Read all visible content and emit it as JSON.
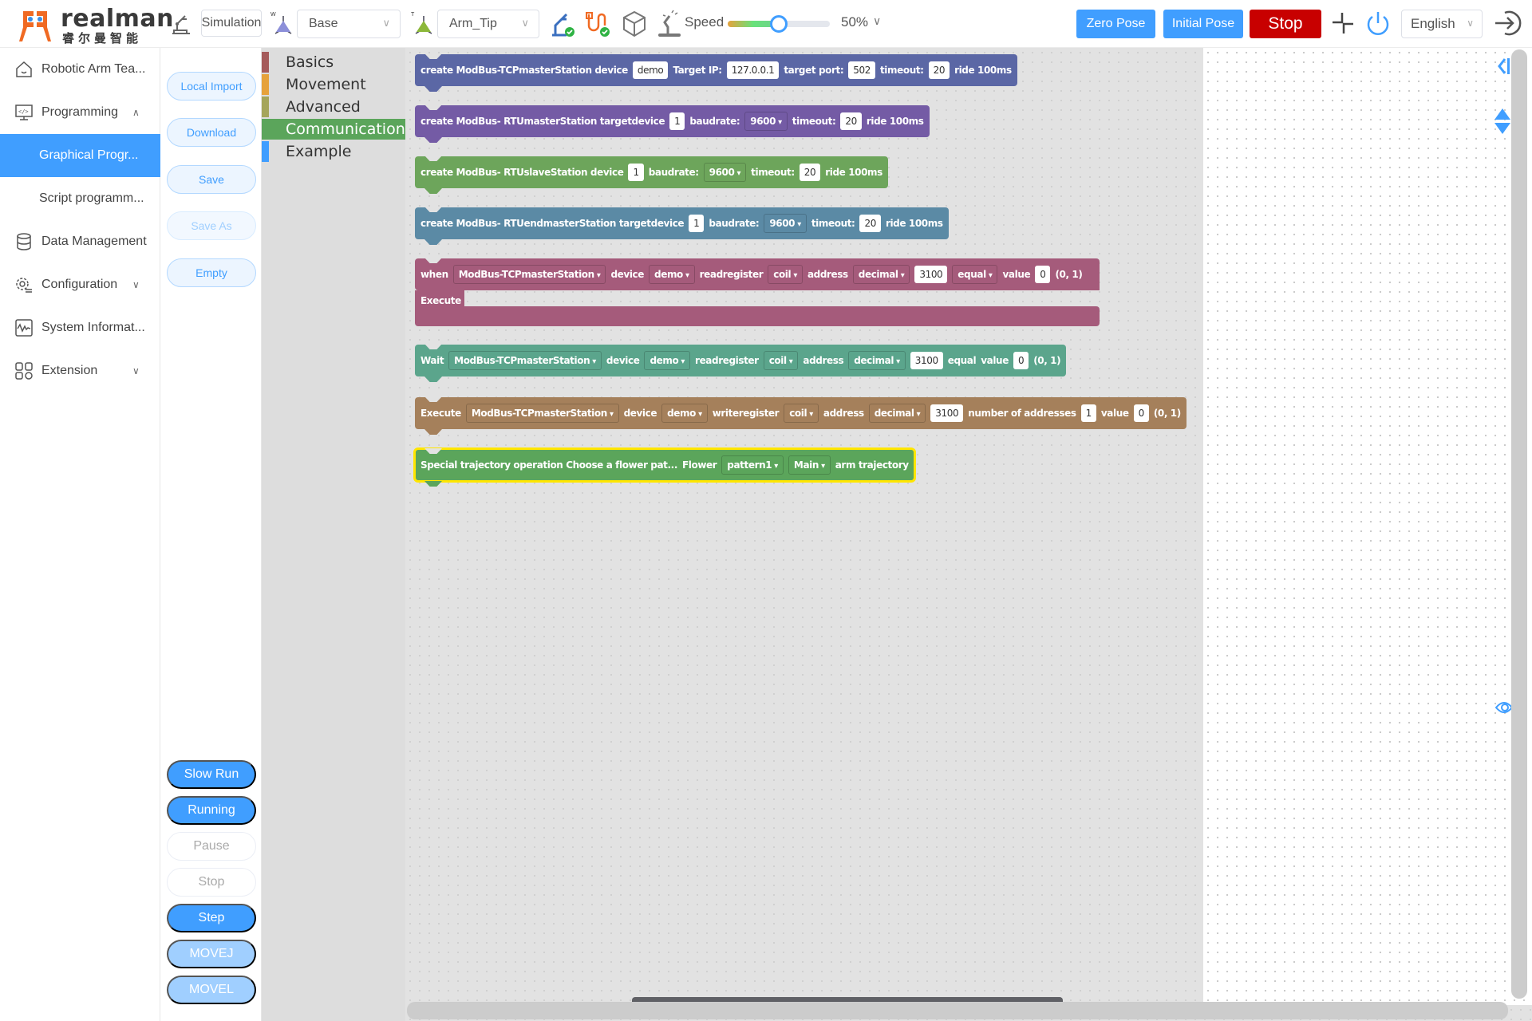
{
  "header": {
    "brand": "realman",
    "brand_cn": "睿尔曼智能",
    "mode": "Simulation",
    "work_frame": "Base",
    "tool_frame": "Arm_Tip",
    "speed_label": "Speed",
    "speed_percent": 50,
    "speed_value_text": "50%",
    "buttons": {
      "zero_pose": "Zero Pose",
      "initial_pose": "Initial Pose",
      "stop": "Stop"
    },
    "language": "English",
    "colors": {
      "accent": "#409eff",
      "stop": "#c80000",
      "logo": "#f06a23"
    }
  },
  "nav": {
    "items": [
      {
        "label": "Robotic Arm Tea...",
        "icon": "home-icon"
      },
      {
        "label": "Programming",
        "icon": "code-monitor-icon",
        "expanded": true
      },
      {
        "label": "Graphical Progr...",
        "active": true
      },
      {
        "label": "Script programm..."
      },
      {
        "label": "Data Management",
        "icon": "database-icon"
      },
      {
        "label": "Configuration",
        "icon": "gear-list-icon"
      },
      {
        "label": "System Informat...",
        "icon": "pulse-icon"
      },
      {
        "label": "Extension",
        "icon": "grid-icon"
      }
    ]
  },
  "actions": {
    "file": [
      "Local Import",
      "Download",
      "Save",
      "Save As",
      "Empty"
    ],
    "run": [
      "Slow Run",
      "Running",
      "Pause",
      "Stop",
      "Step",
      "MOVEJ",
      "MOVEL"
    ]
  },
  "toolbox": {
    "categories": [
      {
        "label": "Basics",
        "color": "#a55b5b"
      },
      {
        "label": "Movement",
        "color": "#e6a23c"
      },
      {
        "label": "Advanced",
        "color": "#a5a55b"
      },
      {
        "label": "Communication",
        "color": "#5ba55b",
        "selected": true
      },
      {
        "label": "Example",
        "color": "#409eff"
      }
    ]
  },
  "blocks": {
    "b1": {
      "t1": "create ModBus-TCPmasterStation device",
      "device": "demo",
      "t2": "Target IP:",
      "ip": "127.0.0.1",
      "t3": "target port:",
      "port": "502",
      "t4": "timeout:",
      "timeout": "20",
      "t5": "ride 100ms"
    },
    "b2": {
      "t1": "create ModBus- RTUmasterStation targetdevice",
      "device": "1",
      "t2": "baudrate:",
      "baud": "9600",
      "t3": "timeout:",
      "timeout": "20",
      "t4": "ride 100ms"
    },
    "b3": {
      "t1": "create ModBus- RTUslaveStation device",
      "device": "1",
      "t2": "baudrate:",
      "baud": "9600",
      "t3": "timeout:",
      "timeout": "20",
      "t4": "ride 100ms"
    },
    "b4": {
      "t1": "create ModBus- RTUendmasterStation targetdevice",
      "device": "1",
      "t2": "baudrate:",
      "baud": "9600",
      "t3": "timeout:",
      "timeout": "20",
      "t4": "ride 100ms"
    },
    "b5": {
      "t1": "when",
      "station": "ModBus-TCPmasterStation",
      "t2": "device",
      "device": "demo",
      "t3": "readregister",
      "reg": "coil",
      "t4": "address",
      "fmt": "decimal",
      "addr": "3100",
      "cmp": "equal",
      "t5": "value",
      "value": "0",
      "range": "(0, 1)",
      "execute": "Execute"
    },
    "b6": {
      "t1": "Wait",
      "station": "ModBus-TCPmasterStation",
      "t2": "device",
      "device": "demo",
      "t3": "readregister",
      "reg": "coil",
      "t4": "address",
      "fmt": "decimal",
      "addr": "3100",
      "t5": "equal",
      "t6": "value",
      "value": "0",
      "range": "(0, 1)"
    },
    "b7": {
      "t1": "Execute",
      "station": "ModBus-TCPmasterStation",
      "t2": "device",
      "device": "demo",
      "t3": "writeregister",
      "reg": "coil",
      "t4": "address",
      "fmt": "decimal",
      "addr": "3100",
      "t5": "number of addresses",
      "count": "1",
      "t6": "value",
      "value": "0",
      "range": "(0, 1)"
    },
    "b8": {
      "t1": "Special trajectory operation Choose a flower pat...",
      "t2": "Flower",
      "pattern": "pattern1",
      "arm": "Main",
      "t3": "arm trajectory"
    }
  }
}
